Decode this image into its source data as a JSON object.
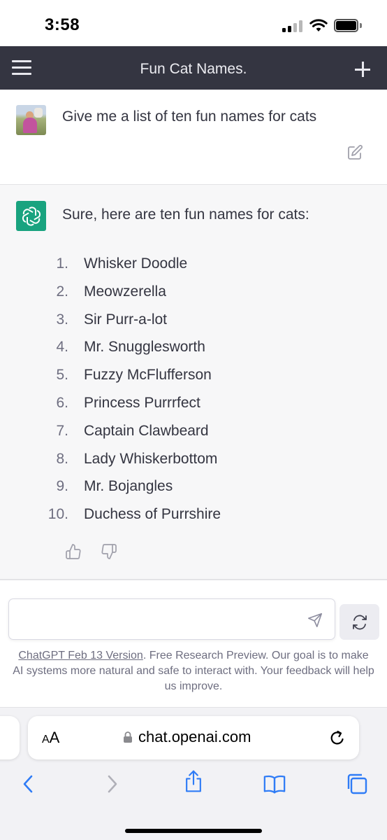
{
  "status_bar": {
    "time": "3:58"
  },
  "header": {
    "title": "Fun Cat Names."
  },
  "user_message": {
    "text": "Give me a list of ten fun names for cats"
  },
  "assistant_message": {
    "intro": "Sure, here are ten fun names for cats:",
    "items": [
      {
        "num": "1.",
        "name": "Whisker Doodle"
      },
      {
        "num": "2.",
        "name": "Meowzerella"
      },
      {
        "num": "3.",
        "name": "Sir Purr-a-lot"
      },
      {
        "num": "4.",
        "name": "Mr. Snugglesworth"
      },
      {
        "num": "5.",
        "name": "Fuzzy McFlufferson"
      },
      {
        "num": "6.",
        "name": "Princess Purrrfect"
      },
      {
        "num": "7.",
        "name": "Captain Clawbeard"
      },
      {
        "num": "8.",
        "name": "Lady Whiskerbottom"
      },
      {
        "num": "9.",
        "name": "Mr. Bojangles"
      },
      {
        "num": "10.",
        "name": "Duchess of Purrshire"
      }
    ]
  },
  "composer": {
    "placeholder": ""
  },
  "footer": {
    "version_link": "ChatGPT Feb 13 Version",
    "note": ". Free Research Preview. Our goal is to make AI systems more natural and safe to interact with. Your feedback will help us improve."
  },
  "browser": {
    "aa_large": "A",
    "aa_small": "A",
    "url": "chat.openai.com"
  },
  "colors": {
    "header_bg": "#343541",
    "assistant_bg": "#f7f7f8",
    "gpt_green": "#19a37f",
    "safari_blue": "#2f7cf6"
  },
  "icons": {
    "menu": "hamburger-icon",
    "new_chat": "plus-icon",
    "edit": "edit-icon",
    "thumb_up": "thumbs-up-icon",
    "thumb_down": "thumbs-down-icon",
    "send": "paper-plane-icon",
    "regenerate": "refresh-icon",
    "lock": "lock-icon",
    "reload": "reload-icon",
    "back": "chevron-left-icon",
    "forward": "chevron-right-icon",
    "share": "share-icon",
    "bookmarks": "book-icon",
    "tabs": "tabs-icon"
  }
}
